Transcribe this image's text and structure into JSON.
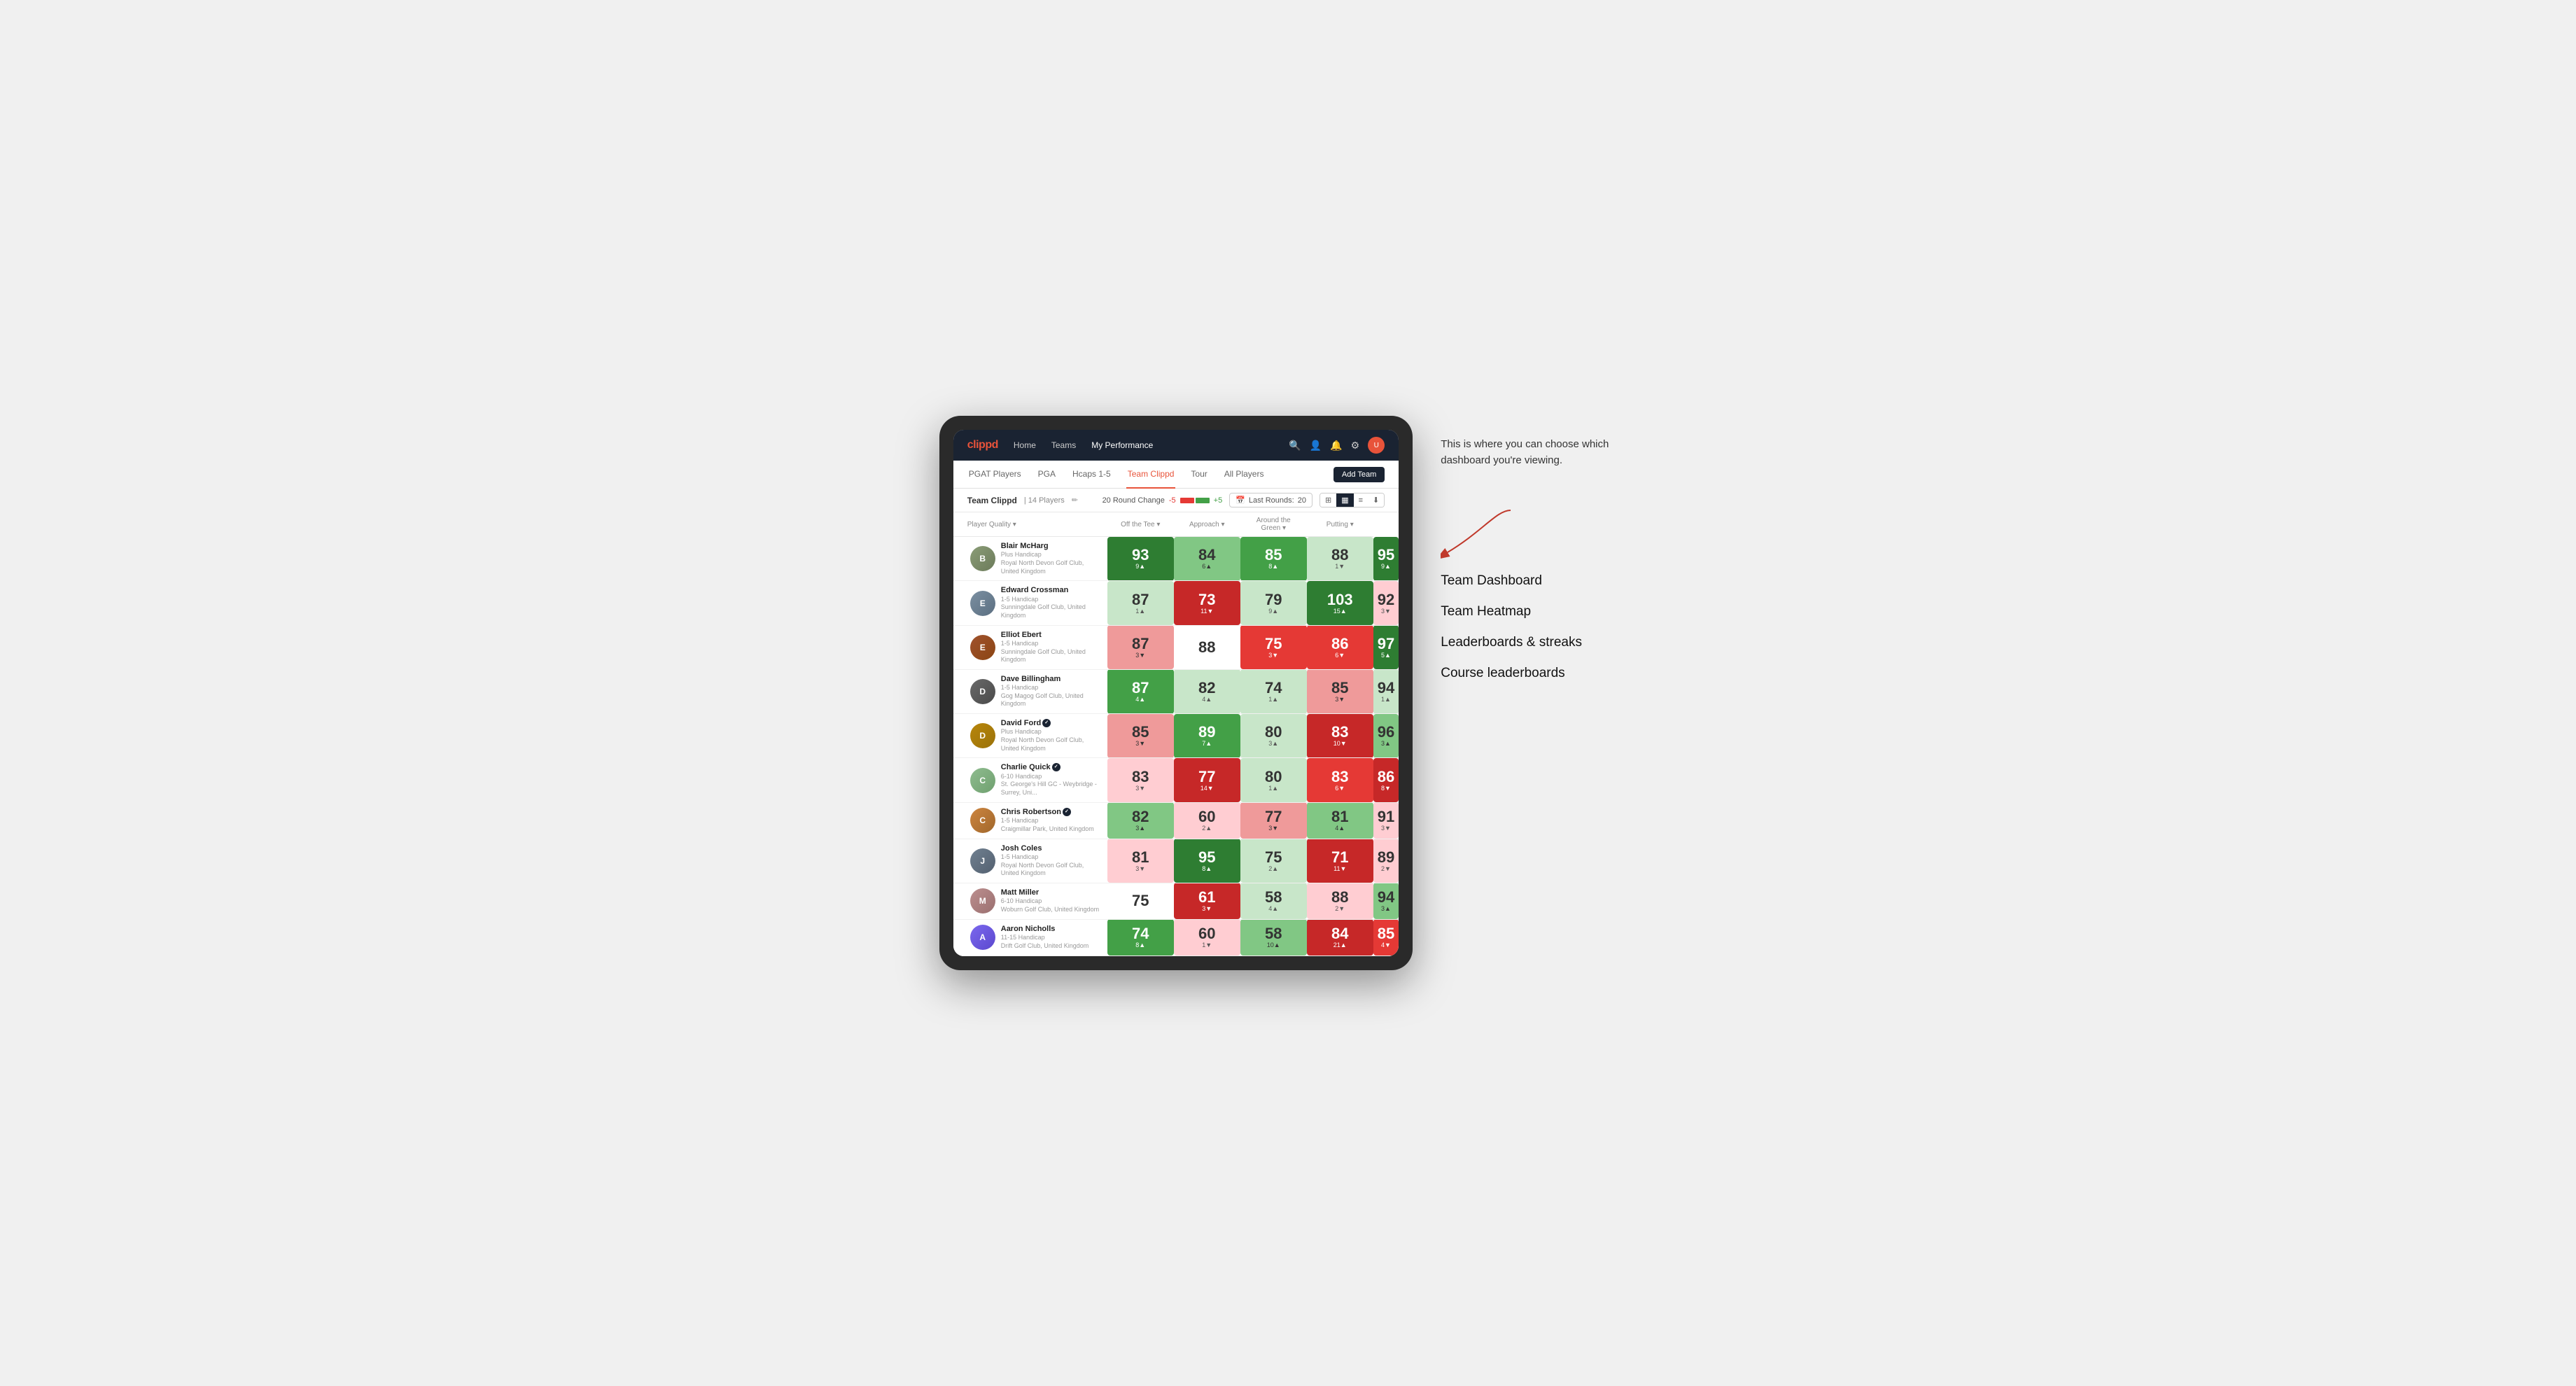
{
  "app": {
    "logo": "clippd",
    "nav": {
      "links": [
        "Home",
        "Teams",
        "My Performance"
      ],
      "active": "My Performance"
    },
    "sub_tabs": [
      "PGAT Players",
      "PGA",
      "Hcaps 1-5",
      "Team Clippd",
      "Tour",
      "All Players"
    ],
    "active_sub_tab": "Team Clippd",
    "add_team_label": "Add Team",
    "team_name": "Team Clippd",
    "team_count": "14 Players",
    "round_change_label": "20 Round Change",
    "round_change_neg": "-5",
    "round_change_pos": "+5",
    "last_rounds_label": "Last Rounds:",
    "last_rounds_value": "20"
  },
  "columns": {
    "player": "Player Quality ▾",
    "off_tee": "Off the Tee ▾",
    "approach": "Approach ▾",
    "around_green": "Around the Green ▾",
    "putting": "Putting ▾"
  },
  "players": [
    {
      "name": "Blair McHarg",
      "handicap": "Plus Handicap",
      "club": "Royal North Devon Golf Club, United Kingdom",
      "avatar_class": "avatar-1",
      "scores": {
        "quality": {
          "val": "93",
          "change": "9▲",
          "color": "green-dark"
        },
        "off_tee": {
          "val": "84",
          "change": "6▲",
          "color": "green-light"
        },
        "approach": {
          "val": "85",
          "change": "8▲",
          "color": "green-med"
        },
        "around": {
          "val": "88",
          "change": "1▼",
          "color": "green-pale"
        },
        "putting": {
          "val": "95",
          "change": "9▲",
          "color": "green-dark"
        }
      }
    },
    {
      "name": "Edward Crossman",
      "handicap": "1-5 Handicap",
      "club": "Sunningdale Golf Club, United Kingdom",
      "avatar_class": "avatar-2",
      "scores": {
        "quality": {
          "val": "87",
          "change": "1▲",
          "color": "green-pale"
        },
        "off_tee": {
          "val": "73",
          "change": "11▼",
          "color": "red-dark"
        },
        "approach": {
          "val": "79",
          "change": "9▲",
          "color": "green-pale"
        },
        "around": {
          "val": "103",
          "change": "15▲",
          "color": "green-dark"
        },
        "putting": {
          "val": "92",
          "change": "3▼",
          "color": "red-pale"
        }
      }
    },
    {
      "name": "Elliot Ebert",
      "handicap": "1-5 Handicap",
      "club": "Sunningdale Golf Club, United Kingdom",
      "avatar_class": "avatar-3",
      "scores": {
        "quality": {
          "val": "87",
          "change": "3▼",
          "color": "red-light"
        },
        "off_tee": {
          "val": "88",
          "change": "",
          "color": "neutral"
        },
        "approach": {
          "val": "75",
          "change": "3▼",
          "color": "red-med"
        },
        "around": {
          "val": "86",
          "change": "6▼",
          "color": "red-med"
        },
        "putting": {
          "val": "97",
          "change": "5▲",
          "color": "green-dark"
        }
      }
    },
    {
      "name": "Dave Billingham",
      "handicap": "1-5 Handicap",
      "club": "Gog Magog Golf Club, United Kingdom",
      "avatar_class": "avatar-4",
      "scores": {
        "quality": {
          "val": "87",
          "change": "4▲",
          "color": "green-med"
        },
        "off_tee": {
          "val": "82",
          "change": "4▲",
          "color": "green-pale"
        },
        "approach": {
          "val": "74",
          "change": "1▲",
          "color": "green-pale"
        },
        "around": {
          "val": "85",
          "change": "3▼",
          "color": "red-light"
        },
        "putting": {
          "val": "94",
          "change": "1▲",
          "color": "green-pale"
        }
      }
    },
    {
      "name": "David Ford",
      "handicap": "Plus Handicap",
      "club": "Royal North Devon Golf Club, United Kingdom",
      "avatar_class": "avatar-5",
      "badge": true,
      "scores": {
        "quality": {
          "val": "85",
          "change": "3▼",
          "color": "red-light"
        },
        "off_tee": {
          "val": "89",
          "change": "7▲",
          "color": "green-med"
        },
        "approach": {
          "val": "80",
          "change": "3▲",
          "color": "green-pale"
        },
        "around": {
          "val": "83",
          "change": "10▼",
          "color": "red-dark"
        },
        "putting": {
          "val": "96",
          "change": "3▲",
          "color": "green-light"
        }
      }
    },
    {
      "name": "Charlie Quick",
      "handicap": "6-10 Handicap",
      "club": "St. George's Hill GC - Weybridge - Surrey, Uni...",
      "avatar_class": "avatar-6",
      "badge": true,
      "scores": {
        "quality": {
          "val": "83",
          "change": "3▼",
          "color": "red-pale"
        },
        "off_tee": {
          "val": "77",
          "change": "14▼",
          "color": "red-dark"
        },
        "approach": {
          "val": "80",
          "change": "1▲",
          "color": "green-pale"
        },
        "around": {
          "val": "83",
          "change": "6▼",
          "color": "red-med"
        },
        "putting": {
          "val": "86",
          "change": "8▼",
          "color": "red-dark"
        }
      }
    },
    {
      "name": "Chris Robertson",
      "handicap": "1-5 Handicap",
      "club": "Craigmillar Park, United Kingdom",
      "avatar_class": "avatar-7",
      "badge": true,
      "scores": {
        "quality": {
          "val": "82",
          "change": "3▲",
          "color": "green-light"
        },
        "off_tee": {
          "val": "60",
          "change": "2▲",
          "color": "red-pale"
        },
        "approach": {
          "val": "77",
          "change": "3▼",
          "color": "red-light"
        },
        "around": {
          "val": "81",
          "change": "4▲",
          "color": "green-light"
        },
        "putting": {
          "val": "91",
          "change": "3▼",
          "color": "red-pale"
        }
      }
    },
    {
      "name": "Josh Coles",
      "handicap": "1-5 Handicap",
      "club": "Royal North Devon Golf Club, United Kingdom",
      "avatar_class": "avatar-8",
      "scores": {
        "quality": {
          "val": "81",
          "change": "3▼",
          "color": "red-pale"
        },
        "off_tee": {
          "val": "95",
          "change": "8▲",
          "color": "green-dark"
        },
        "approach": {
          "val": "75",
          "change": "2▲",
          "color": "green-pale"
        },
        "around": {
          "val": "71",
          "change": "11▼",
          "color": "red-dark"
        },
        "putting": {
          "val": "89",
          "change": "2▼",
          "color": "red-pale"
        }
      }
    },
    {
      "name": "Matt Miller",
      "handicap": "6-10 Handicap",
      "club": "Woburn Golf Club, United Kingdom",
      "avatar_class": "avatar-9",
      "scores": {
        "quality": {
          "val": "75",
          "change": "",
          "color": "neutral"
        },
        "off_tee": {
          "val": "61",
          "change": "3▼",
          "color": "red-dark"
        },
        "approach": {
          "val": "58",
          "change": "4▲",
          "color": "green-pale"
        },
        "around": {
          "val": "88",
          "change": "2▼",
          "color": "red-pale"
        },
        "putting": {
          "val": "94",
          "change": "3▲",
          "color": "green-light"
        }
      }
    },
    {
      "name": "Aaron Nicholls",
      "handicap": "11-15 Handicap",
      "club": "Drift Golf Club, United Kingdom",
      "avatar_class": "avatar-10",
      "scores": {
        "quality": {
          "val": "74",
          "change": "8▲",
          "color": "green-med"
        },
        "off_tee": {
          "val": "60",
          "change": "1▼",
          "color": "red-pale"
        },
        "approach": {
          "val": "58",
          "change": "10▲",
          "color": "green-light"
        },
        "around": {
          "val": "84",
          "change": "21▲",
          "color": "red-dark"
        },
        "putting": {
          "val": "85",
          "change": "4▼",
          "color": "red-med"
        }
      }
    }
  ],
  "annotation": {
    "note": "This is where you can choose which dashboard you're viewing.",
    "menu_items": [
      "Team Dashboard",
      "Team Heatmap",
      "Leaderboards & streaks",
      "Course leaderboards"
    ]
  }
}
